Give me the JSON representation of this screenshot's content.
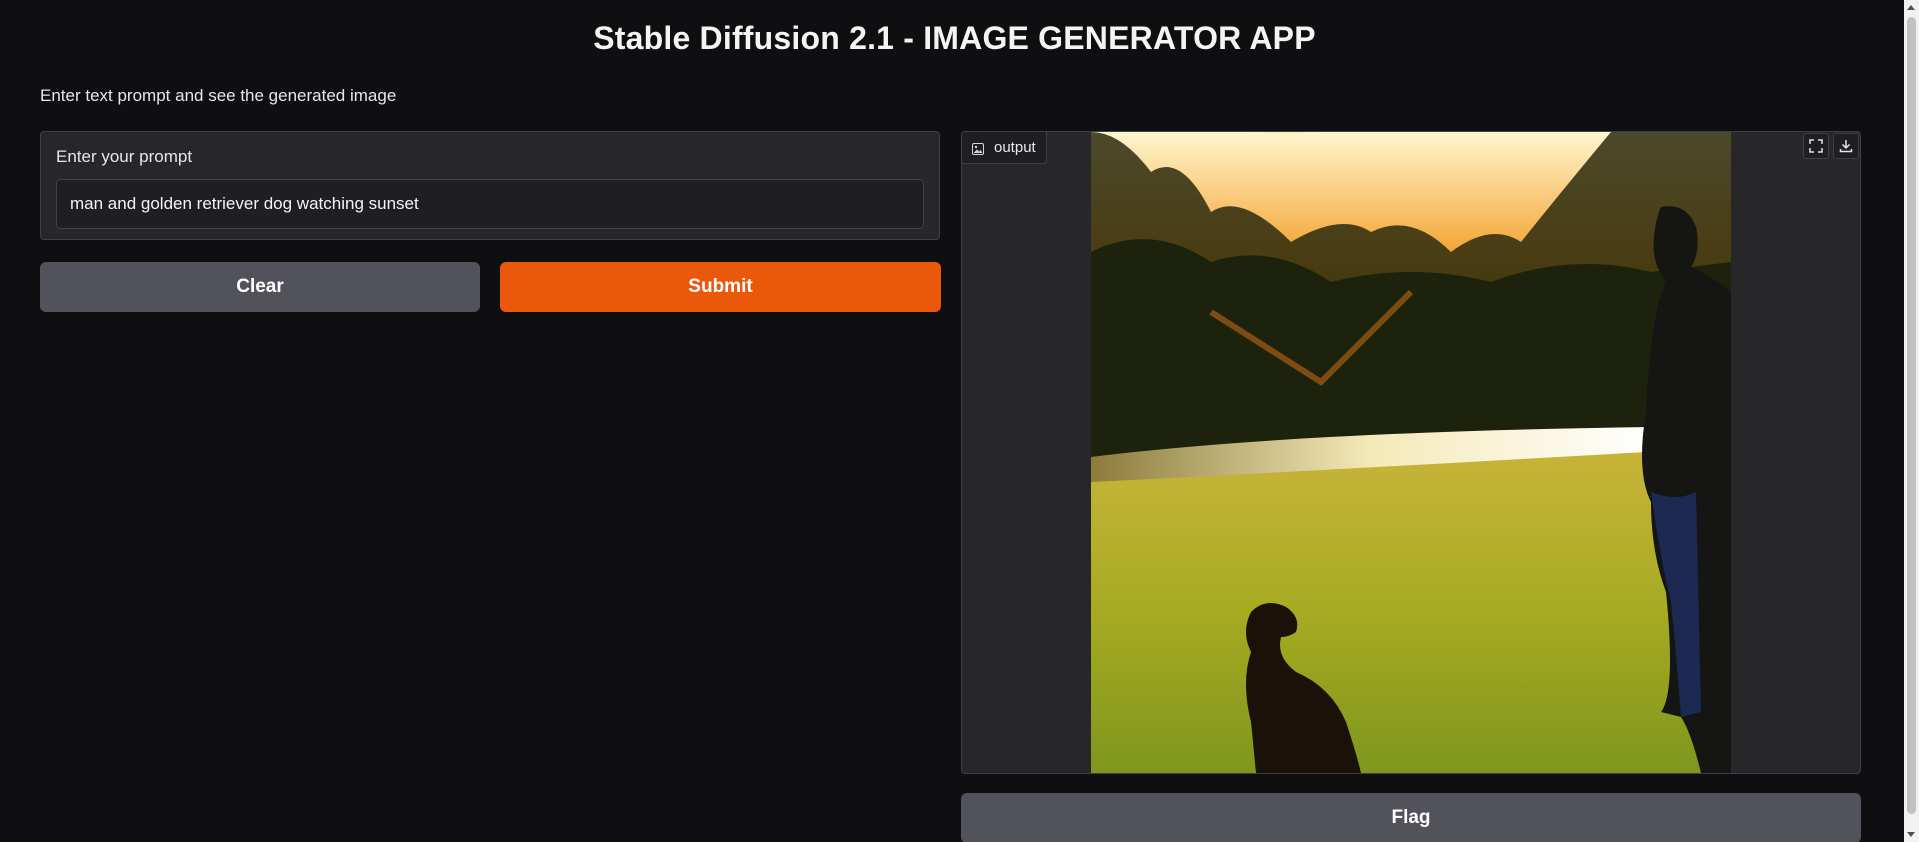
{
  "app": {
    "title": "Stable Diffusion 2.1 - IMAGE GENERATOR APP",
    "description": "Enter text prompt and see the generated image"
  },
  "input": {
    "label": "Enter your prompt",
    "value": "man and golden retriever dog watching sunset"
  },
  "buttons": {
    "clear_label": "Clear",
    "submit_label": "Submit",
    "flag_label": "Flag"
  },
  "output": {
    "label": "output",
    "image_alt": "man and golden retriever dog watching sunset",
    "icons": [
      "fullscreen-icon",
      "download-icon"
    ]
  },
  "colors": {
    "background": "#0f0f11",
    "panel": "#27272a",
    "primary_button": "#ea580c",
    "secondary_button": "#52525b"
  }
}
